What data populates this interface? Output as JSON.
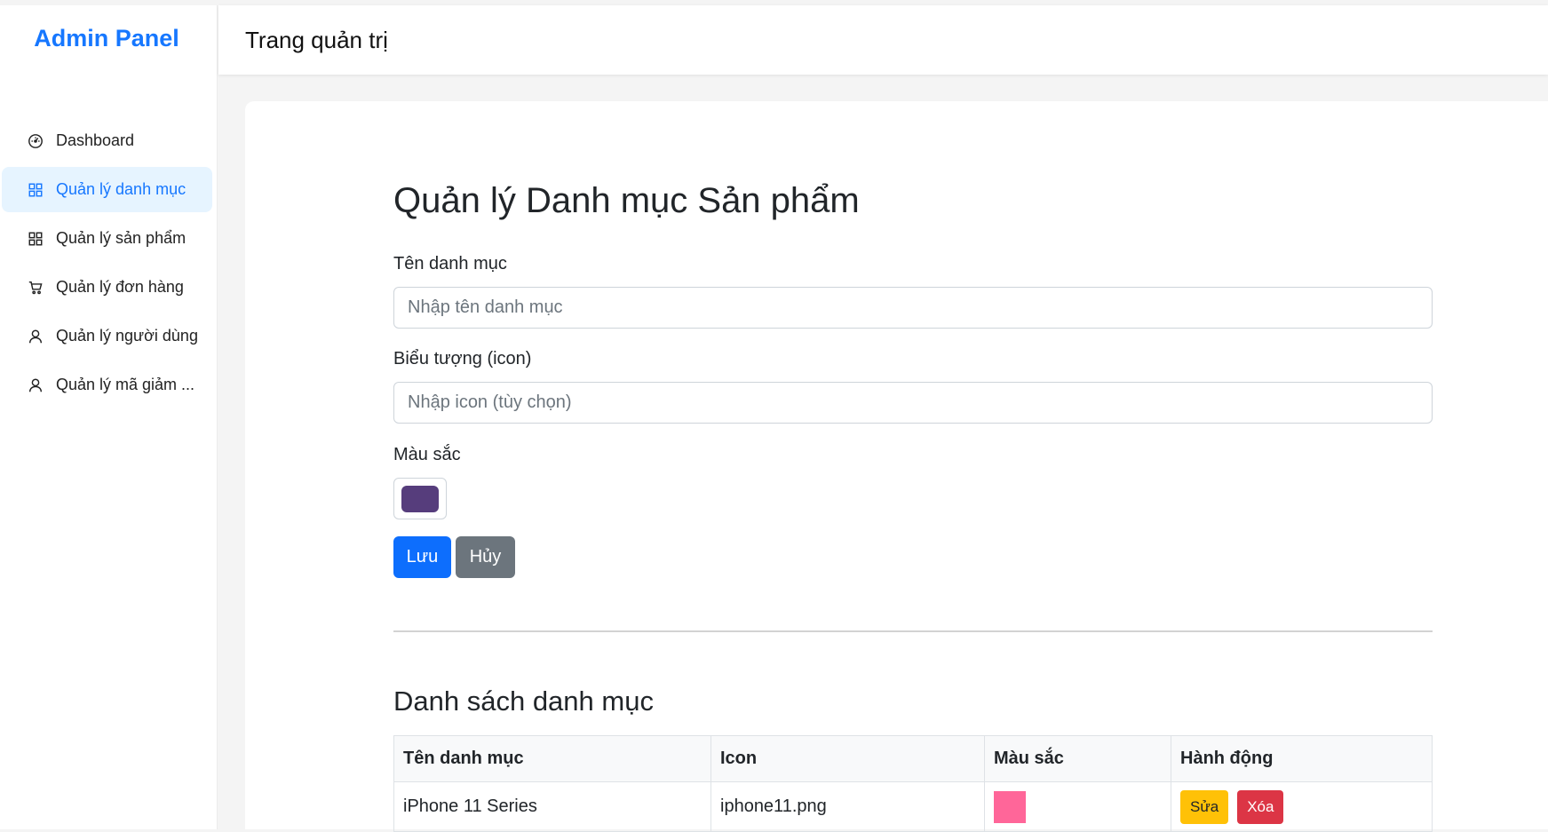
{
  "sidebar": {
    "logo": "Admin Panel",
    "items": [
      {
        "label": "Dashboard",
        "icon": "dashboard-icon"
      },
      {
        "label": "Quản lý danh mục",
        "icon": "grid-icon",
        "active": true
      },
      {
        "label": "Quản lý sản phẩm",
        "icon": "grid-icon"
      },
      {
        "label": "Quản lý đơn hàng",
        "icon": "cart-icon"
      },
      {
        "label": "Quản lý người dùng",
        "icon": "user-icon"
      },
      {
        "label": "Quản lý mã giảm ...",
        "icon": "user-icon"
      }
    ]
  },
  "header": {
    "title": "Trang quản trị"
  },
  "main": {
    "title": "Quản lý Danh mục Sản phẩm",
    "form": {
      "name_label": "Tên danh mục",
      "name_placeholder": "Nhập tên danh mục",
      "icon_label": "Biểu tượng (icon)",
      "icon_placeholder": "Nhập icon (tùy chọn)",
      "color_label": "Màu sắc",
      "color_value": "#563d7c",
      "save_label": "Lưu",
      "cancel_label": "Hủy"
    },
    "list_title": "Danh sách danh mục",
    "table": {
      "headers": [
        "Tên danh mục",
        "Icon",
        "Màu sắc",
        "Hành động"
      ],
      "rows": [
        {
          "name": "iPhone 11 Series",
          "icon": "iphone11.png",
          "color": "#ff6699",
          "edit_label": "Sửa",
          "delete_label": "Xóa"
        }
      ]
    }
  },
  "colors": {
    "accent": "#1677ff",
    "active_bg": "#e6f4ff",
    "primary_button": "#0d6efd",
    "secondary_button": "#6c757d",
    "warning_button": "#ffc107",
    "danger_button": "#dc3545"
  }
}
